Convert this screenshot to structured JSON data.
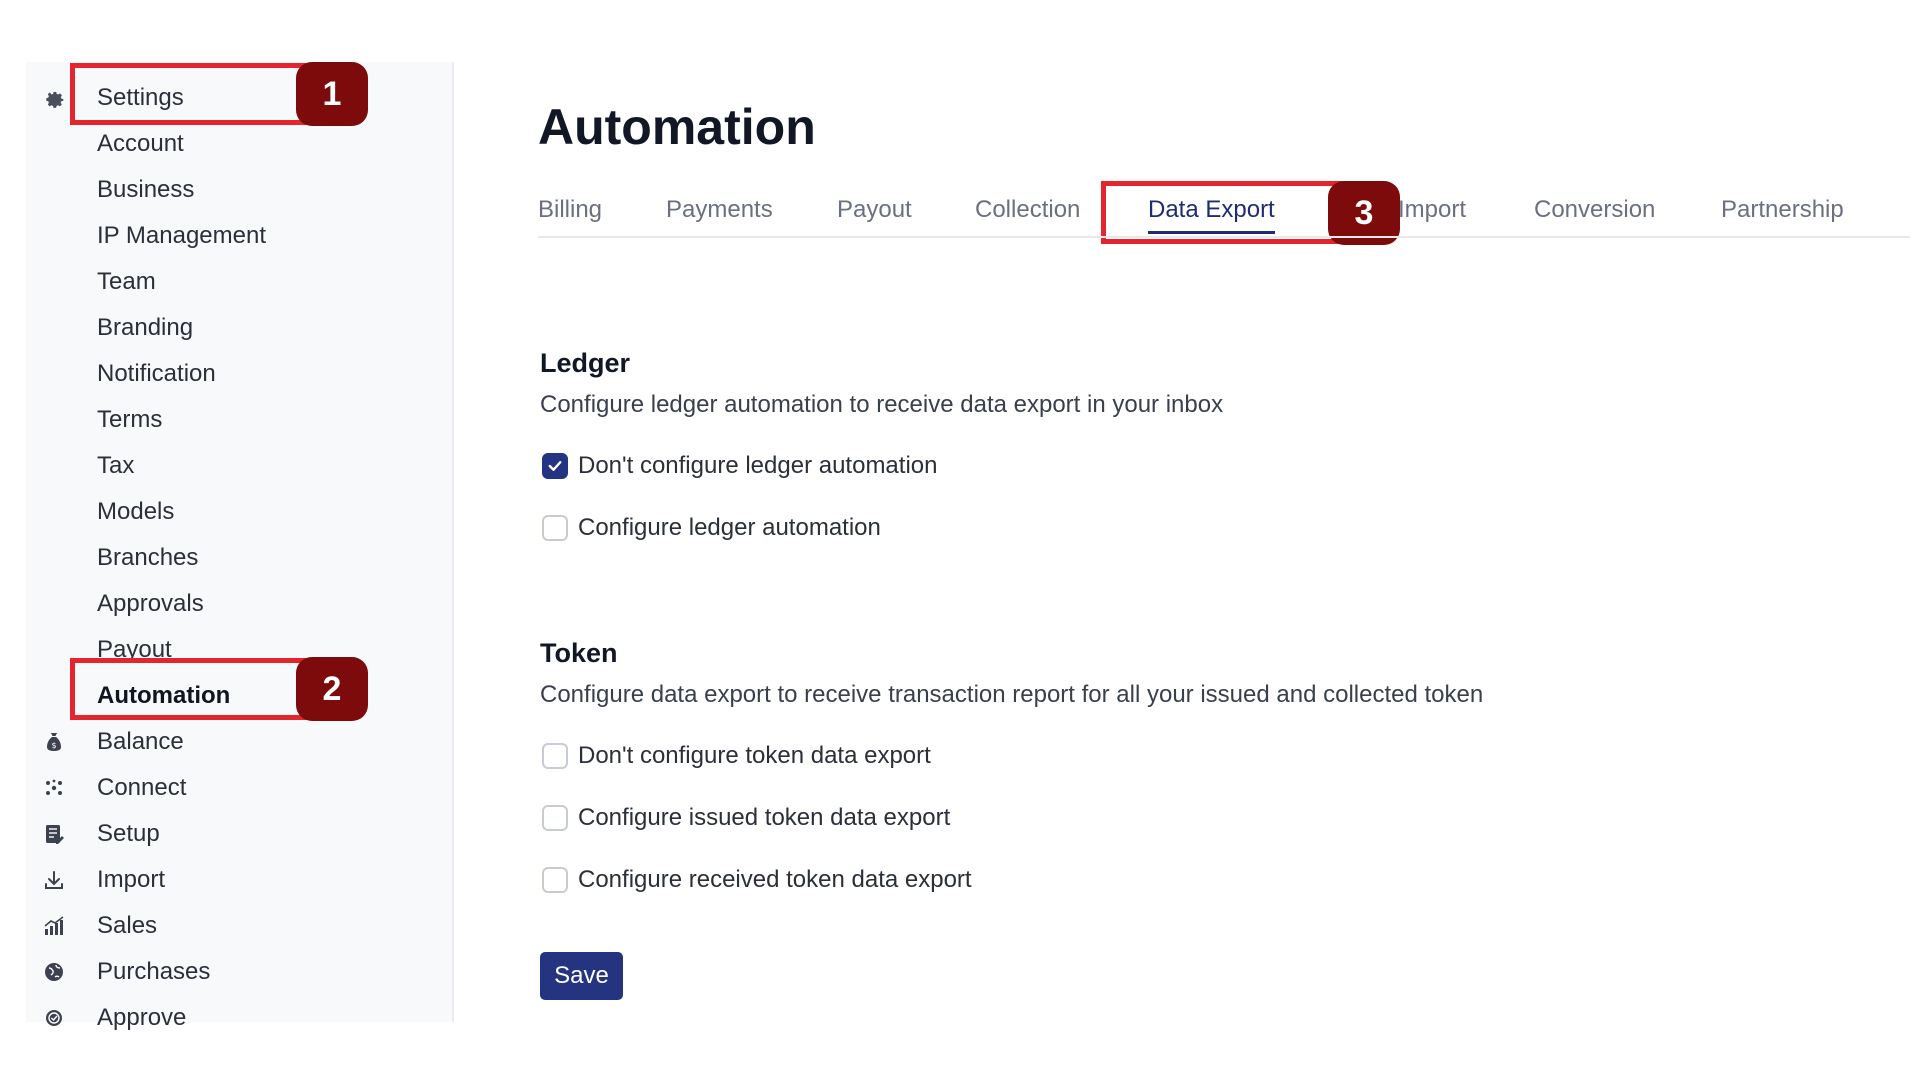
{
  "sidebar": {
    "items": [
      {
        "label": "Settings",
        "icon": "gear-icon"
      },
      {
        "label": "Account"
      },
      {
        "label": "Business"
      },
      {
        "label": "IP Management"
      },
      {
        "label": "Team"
      },
      {
        "label": "Branding"
      },
      {
        "label": "Notification"
      },
      {
        "label": "Terms"
      },
      {
        "label": "Tax"
      },
      {
        "label": "Models"
      },
      {
        "label": "Branches"
      },
      {
        "label": "Approvals"
      },
      {
        "label": "Payout"
      },
      {
        "label": "Automation",
        "active": true
      },
      {
        "label": "Balance",
        "icon": "money-bag-icon"
      },
      {
        "label": "Connect",
        "icon": "connect-icon"
      },
      {
        "label": "Setup",
        "icon": "setup-icon"
      },
      {
        "label": "Import",
        "icon": "download-icon"
      },
      {
        "label": "Sales",
        "icon": "chart-icon"
      },
      {
        "label": "Purchases",
        "icon": "globe-icon"
      },
      {
        "label": "Approve",
        "icon": "check-circle-icon"
      }
    ]
  },
  "annotations": {
    "badge_1": "1",
    "badge_2": "2",
    "badge_3": "3",
    "color": "#e5252d",
    "badge_color": "#7e0b0b"
  },
  "main": {
    "title": "Automation",
    "tabs": [
      {
        "label": "Billing"
      },
      {
        "label": "Payments"
      },
      {
        "label": "Payout"
      },
      {
        "label": "Collection"
      },
      {
        "label": "Data Export",
        "active": true
      },
      {
        "label": "Import"
      },
      {
        "label": "Conversion"
      },
      {
        "label": "Partnership"
      }
    ],
    "ledger": {
      "title": "Ledger",
      "description": "Configure ledger automation to receive data export in your inbox",
      "options": [
        {
          "label": "Don't configure ledger automation",
          "checked": true
        },
        {
          "label": "Configure ledger automation",
          "checked": false
        }
      ]
    },
    "token": {
      "title": "Token",
      "description": "Configure data export to receive transaction report for all your issued and collected token",
      "options": [
        {
          "label": "Don't configure token data export",
          "checked": false
        },
        {
          "label": "Configure issued token data export",
          "checked": false
        },
        {
          "label": "Configure received token data export",
          "checked": false
        }
      ]
    },
    "save_label": "Save"
  },
  "colors": {
    "accent": "#243382",
    "active_tab": "#1f2c73"
  }
}
